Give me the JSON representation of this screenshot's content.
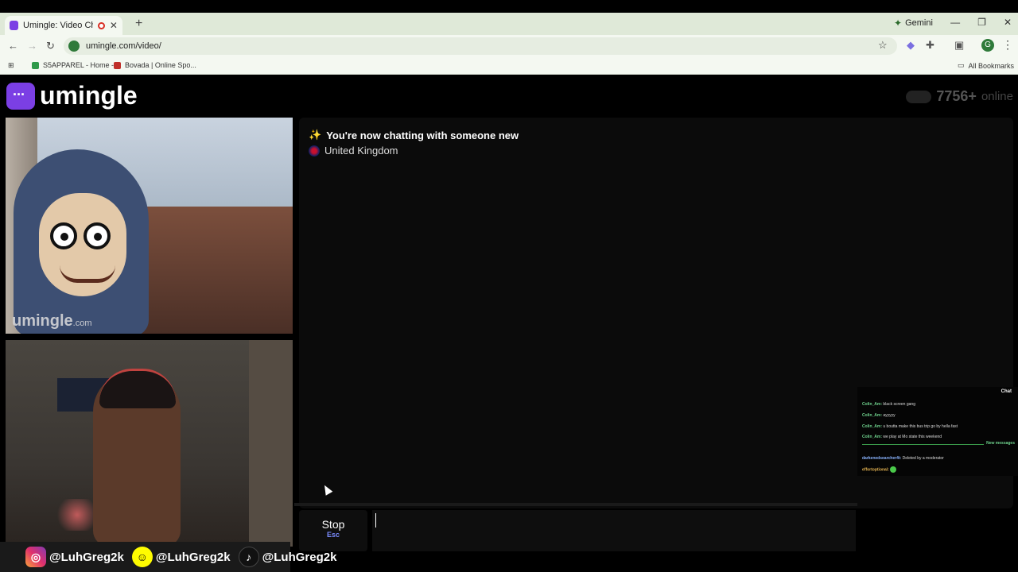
{
  "browser": {
    "tab_title": "Umingle: Video Chat with St",
    "new_tab": "+",
    "gemini": "Gemini",
    "url": "umingle.com/video/",
    "bookmarks": [
      "S5APPAREL - Home -...",
      "Bovada | Online Spo..."
    ],
    "all_bookmarks": "All Bookmarks",
    "profile_initial": "G"
  },
  "site": {
    "logo": "umingle",
    "online_count": "7756+",
    "online_label": "online",
    "watermark": "umingle",
    "watermark_suffix": ".com"
  },
  "chat": {
    "status": "You're now chatting with someone new",
    "country": "United Kingdom",
    "stop_label": "Stop",
    "stop_key": "Esc",
    "input_value": ""
  },
  "socials": [
    {
      "icon": "instagram-icon",
      "handle": "@LuhGreg2k"
    },
    {
      "icon": "snapchat-icon",
      "handle": "@LuhGreg2k"
    },
    {
      "icon": "tiktok-icon",
      "handle": "@LuhGreg2k"
    }
  ],
  "stream_chat": {
    "header": "Chat",
    "new_messages": "New messages",
    "messages": [
      {
        "user": "Colin_Am:",
        "text": "black screen gang"
      },
      {
        "user": "Colin_Am:",
        "text": "ayyyyy"
      },
      {
        "user": "Colin_Am:",
        "text": "u boutta make this bus trip go by hella fast"
      },
      {
        "user": "Colin_Am:",
        "text": "we play at Mo state this weekend"
      },
      {
        "user": "darkenedsearcher4t:",
        "text": "Deleted by a moderator"
      },
      {
        "user": "effortoptional:",
        "text": ""
      }
    ]
  },
  "colors": {
    "accent": "#7b3fe4",
    "background": "#000000",
    "stop_key": "#7b8cff"
  }
}
